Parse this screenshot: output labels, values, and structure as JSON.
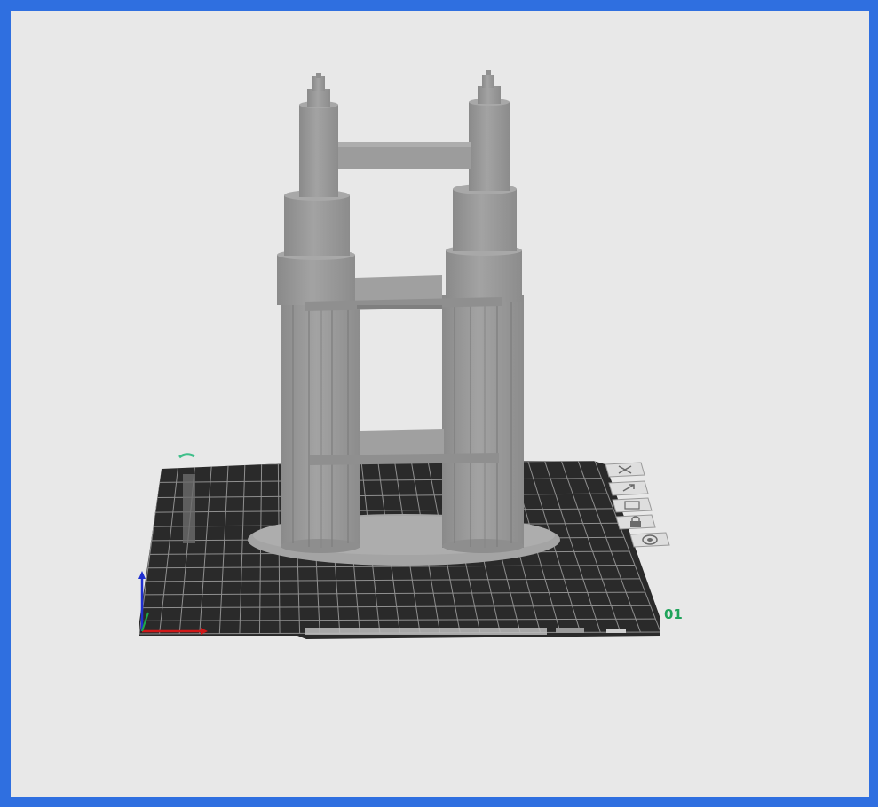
{
  "viewport": {
    "background_color": "#e8e8e8",
    "frame_color": "#2f6fe0"
  },
  "build_plate": {
    "plate_number": "01",
    "plate_color": "#2a2a2a",
    "grid_color": "#8f8f8f",
    "label_color": "#1fa35a"
  },
  "plate_tools": [
    {
      "icon": "close-icon"
    },
    {
      "icon": "auto-orient-icon"
    },
    {
      "icon": "arrange-icon"
    },
    {
      "icon": "lock-icon"
    },
    {
      "icon": "settings-icon"
    }
  ],
  "axes": {
    "x_color": "#d01818",
    "y_color": "#1ea84a",
    "z_color": "#1f2fd0"
  },
  "model": {
    "color": "#9a9a9a"
  }
}
